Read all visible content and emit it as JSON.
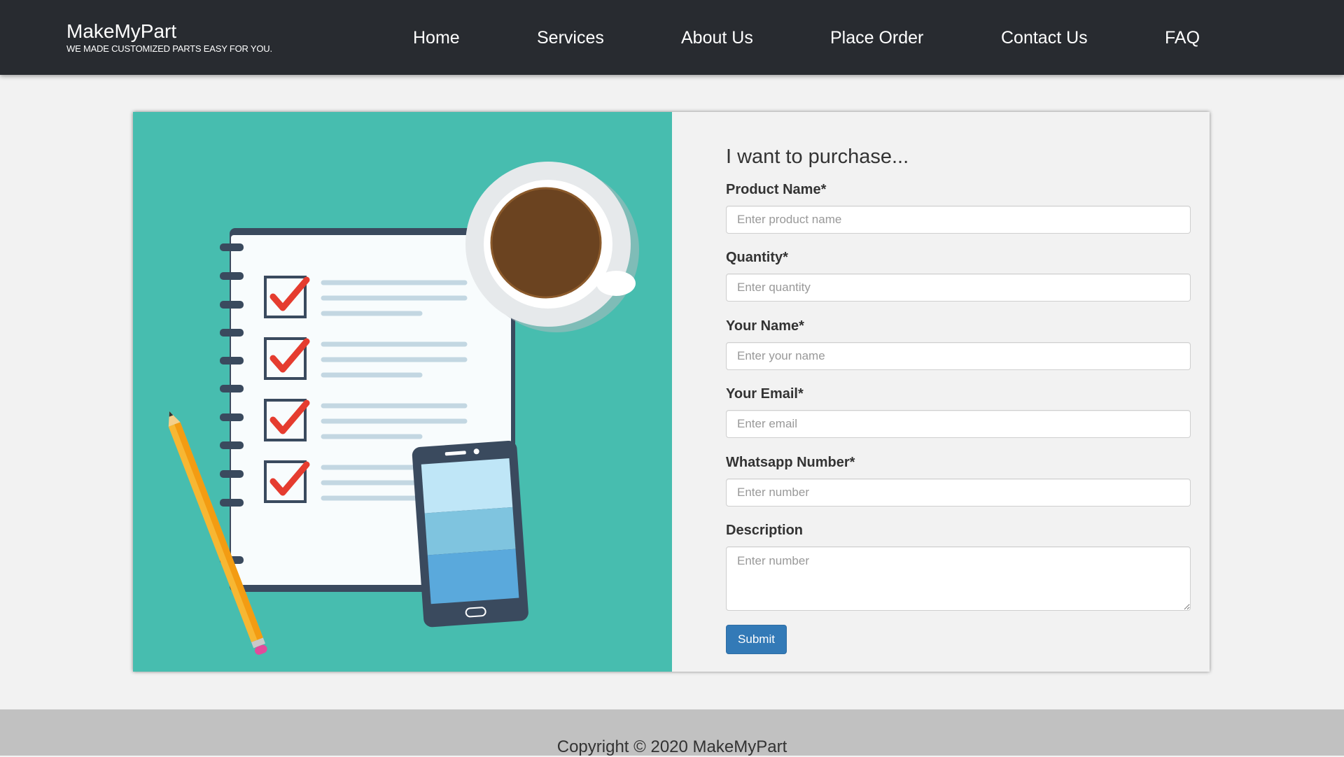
{
  "brand": {
    "name": "MakeMyPart",
    "tagline": "WE MADE CUSTOMIZED PARTS EASY FOR YOU."
  },
  "nav": {
    "items": [
      "Home",
      "Services",
      "About Us",
      "Place Order",
      "Contact Us",
      "FAQ"
    ]
  },
  "illustration": {
    "background_color": "#47bdaf",
    "icons": [
      "checklist-notebook-icon",
      "coffee-cup-icon",
      "smartphone-icon",
      "pencil-icon"
    ]
  },
  "form": {
    "title": "I want to purchase...",
    "fields": [
      {
        "label": "Product Name*",
        "placeholder": "Enter product name",
        "value": ""
      },
      {
        "label": "Quantity*",
        "placeholder": "Enter quantity",
        "value": ""
      },
      {
        "label": "Your Name*",
        "placeholder": "Enter your name",
        "value": ""
      },
      {
        "label": "Your Email*",
        "placeholder": "Enter email",
        "value": ""
      },
      {
        "label": "Whatsapp Number*",
        "placeholder": "Enter number",
        "value": ""
      }
    ],
    "description": {
      "label": "Description",
      "placeholder": "Enter number",
      "value": ""
    },
    "submit_label": "Submit"
  },
  "footer": {
    "copyright": "Copyright © 2020 MakeMyPart"
  },
  "colors": {
    "navbar": "#282b30",
    "accent": "#337ab7",
    "footer": "#c1c1c1",
    "illustration": "#47bdaf"
  }
}
